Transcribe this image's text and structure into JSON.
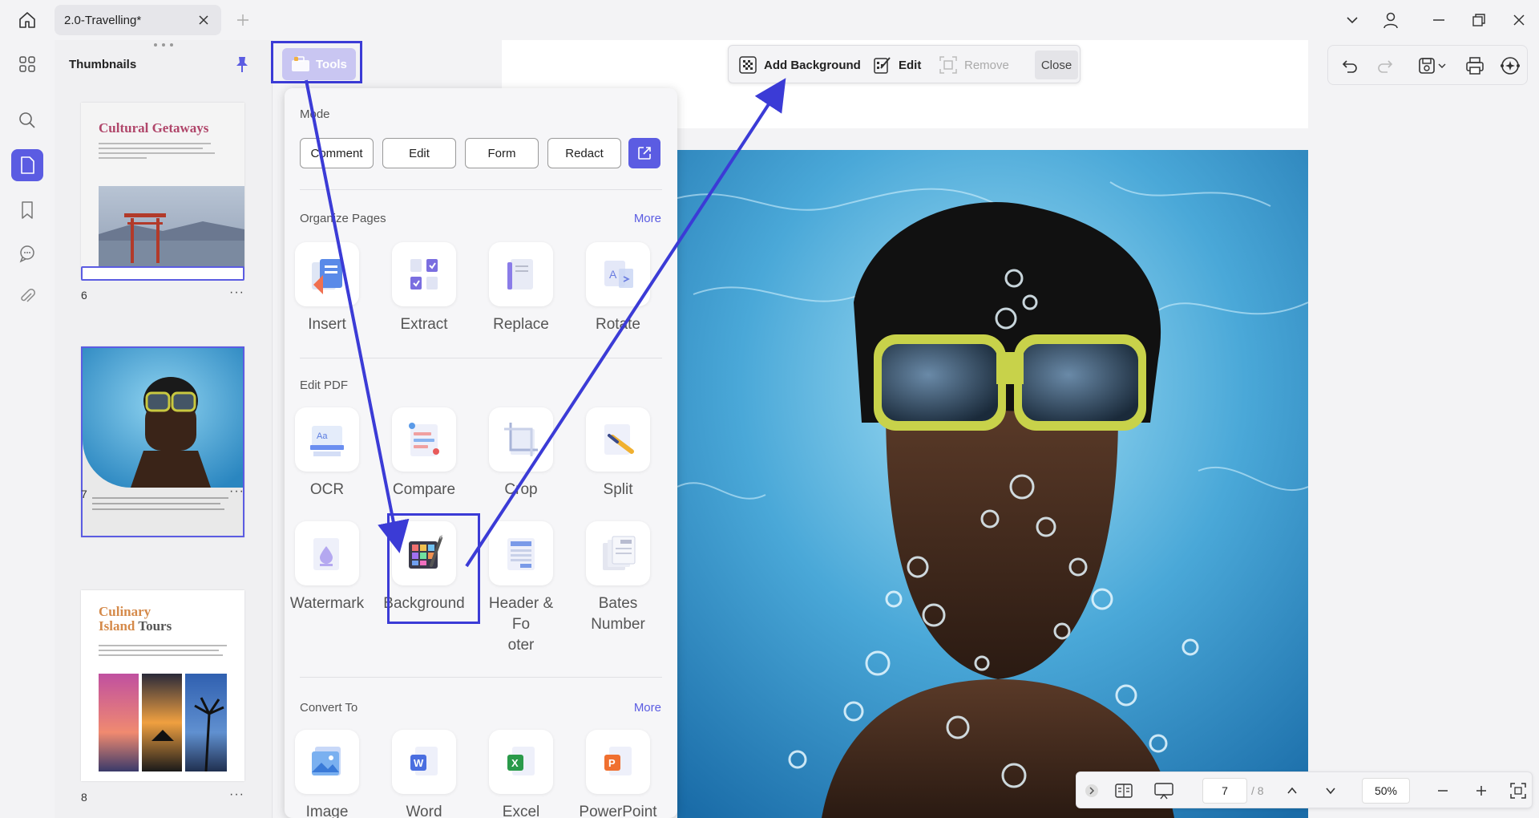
{
  "tab": {
    "title": "2.0-Travelling*"
  },
  "thumbnails": {
    "title": "Thumbnails",
    "pages": [
      {
        "number": "6",
        "heading": "Cultural Getaways"
      },
      {
        "number": "7"
      },
      {
        "number": "8",
        "heading_line1": "Culinary",
        "heading_line2a": "Island",
        "heading_line2b": " Tours"
      }
    ],
    "more": "···"
  },
  "tools_button": {
    "label": "Tools"
  },
  "panel": {
    "mode": {
      "title": "Mode",
      "buttons": [
        "Comment",
        "Edit",
        "Form",
        "Redact"
      ]
    },
    "organize": {
      "title": "Organize Pages",
      "more": "More",
      "tools": [
        "Insert",
        "Extract",
        "Replace",
        "Rotate"
      ]
    },
    "edit_pdf": {
      "title": "Edit PDF",
      "tools": [
        "OCR",
        "Compare",
        "Crop",
        "Split",
        "Watermark",
        "Background",
        "Header &\nFo\noter",
        "Bates\nNumber"
      ]
    },
    "convert": {
      "title": "Convert To",
      "more": "More",
      "tools": [
        "Image",
        "Word",
        "Excel",
        "PowerPoint"
      ]
    }
  },
  "bg_toolbar": {
    "add": "Add Background",
    "edit": "Edit",
    "remove": "Remove",
    "close": "Close"
  },
  "bottom_bar": {
    "page_value": "7",
    "page_total": "/ 8",
    "zoom": "50%"
  },
  "colors": {
    "accent": "#5b5ce2",
    "highlight": "#3b3bd6",
    "thumb_pink": "#c0392b"
  }
}
